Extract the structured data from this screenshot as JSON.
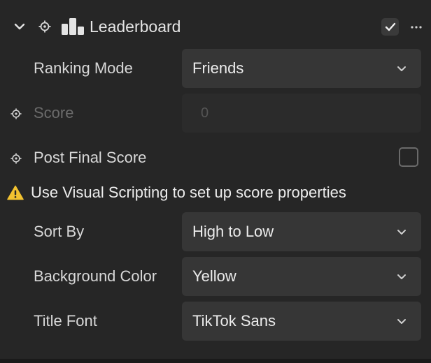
{
  "header": {
    "title": "Leaderboard",
    "enabled": true,
    "icons": [
      "chevron-down-icon",
      "target-icon",
      "leaderboard-icon",
      "checkmark-icon",
      "more-horizontal-icon"
    ]
  },
  "rows": {
    "ranking_mode": {
      "label": "Ranking Mode",
      "value": "Friends"
    },
    "score": {
      "label": "Score",
      "value": "0"
    },
    "post_final_score": {
      "label": "Post Final Score",
      "checked": false
    },
    "sort_by": {
      "label": "Sort By",
      "value": "High to Low"
    },
    "background_color": {
      "label": "Background Color",
      "value": "Yellow"
    },
    "title_font": {
      "label": "Title Font",
      "value": "TikTok Sans"
    }
  },
  "warning": {
    "text": "Use Visual Scripting to set up score properties",
    "icon": "warning-icon"
  },
  "colors": {
    "panel_bg": "#262626",
    "field_bg": "#363636",
    "warning_yellow": "#f2c230",
    "text_primary": "#e6e6e6",
    "text_disabled": "#6b6b6b"
  }
}
